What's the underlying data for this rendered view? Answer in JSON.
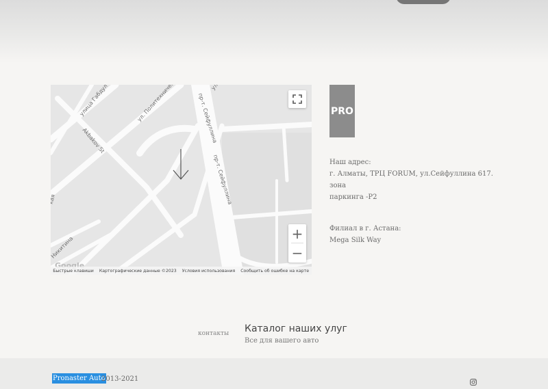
{
  "map": {
    "street_labels": [
      "улица Габдул",
      "ул. Политехническ",
      "пр-т. Сейфуллина",
      "пр-т. Сейфуллина",
      "Akbakov St",
      "Никитина",
      "кая",
      "ул."
    ],
    "footer_links": [
      "Быстрые клавиши",
      "Картографические данные ©2023",
      "Условия использования",
      "Сообщить об ошибке на карте"
    ],
    "zoom_in": "+",
    "zoom_out": "−",
    "google_logo": "Google"
  },
  "logo": {
    "text": "PRO"
  },
  "address": {
    "label": "Наш адрес:",
    "line1": "г. Алматы, ТРЦ FORUM, ул.Сейфуллина 617. зона",
    "line2": "паркинга -Р2"
  },
  "branch": {
    "label": "Филиал в г. Астана:",
    "value": "Mega Silk Way"
  },
  "catalog": {
    "image_alt": "контакты",
    "title": "Каталог наших улуг",
    "subtitle": "Все для вашего авто"
  },
  "footer": {
    "brand": "Pronaster Auto",
    "years": "2013-2021",
    "social_icon": "instagram-icon"
  },
  "colors": {
    "accent": "#2a8fe0",
    "logo_bg": "#8c8c8c",
    "page_bg": "#f6f5f3"
  }
}
